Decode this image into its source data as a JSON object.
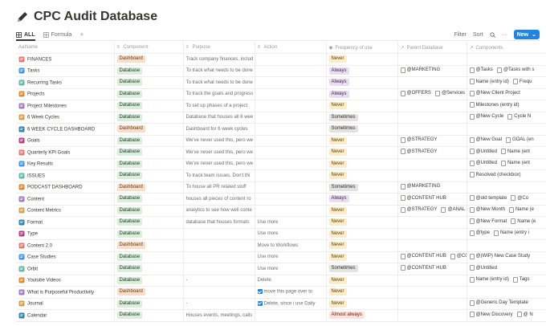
{
  "page": {
    "title": "CPC Audit Database",
    "title_icon": "pencil-icon"
  },
  "views": {
    "tabs": [
      {
        "label": "ALL",
        "icon": "table-icon",
        "active": true
      },
      {
        "label": "Formula",
        "icon": "table-icon",
        "active": false
      }
    ],
    "add_view": "+",
    "filter": "Filter",
    "sort": "Sort",
    "search_icon": "search-icon",
    "more": "···",
    "new_button": "New",
    "new_chevron": "⌄"
  },
  "columns": [
    {
      "label": "Name",
      "icon": "Aa"
    },
    {
      "label": "Component",
      "icon": "≡"
    },
    {
      "label": "Purpose",
      "icon": "≡"
    },
    {
      "label": "Action",
      "icon": "≡"
    },
    {
      "label": "Frequency of use",
      "icon": "◉"
    },
    {
      "label": "Parent Database",
      "icon": "↗"
    },
    {
      "label": "Components",
      "icon": "↗"
    }
  ],
  "colors": {
    "Dashboard": "#fadec9",
    "Database": "#dbeddb",
    "Never": "#fdecc8",
    "Always": "#e8deee",
    "Sometimes": "#e3e2e0",
    "Almost always": "#ffe2dd",
    "accent": "#2383e2"
  },
  "rows": [
    {
      "name": "FINANCES",
      "icon": "money-icon",
      "component": "Dashboard",
      "purpose": "Track company finances, includ",
      "action": "",
      "frequency": "Never",
      "parent": [],
      "components": []
    },
    {
      "name": "Tasks",
      "icon": "task-list-icon",
      "component": "Database",
      "purpose": "To track what needs to be done",
      "action": "",
      "frequency": "Always",
      "parent": [
        "@MARKETING"
      ],
      "components": [
        "@Tasks",
        "@Tasks with s"
      ]
    },
    {
      "name": "Recurring Tasks",
      "icon": "recurring-icon",
      "component": "Database",
      "purpose": "To track what needs to be done",
      "action": "",
      "frequency": "Always",
      "parent": [],
      "components": [
        "Name (entry id)",
        "Frequ"
      ]
    },
    {
      "name": "Projects",
      "icon": "projects-icon",
      "component": "Database",
      "purpose": "To track the goals and progress",
      "action": "",
      "frequency": "Always",
      "parent": [
        "@OFFERS",
        "@Services"
      ],
      "components": [
        "@New Client Project"
      ]
    },
    {
      "name": "Project Milestones",
      "icon": "milestone-icon",
      "component": "Database",
      "purpose": "To set up phases of a project",
      "action": "",
      "frequency": "Never",
      "parent": [],
      "components": [
        "Milestones (entry id)"
      ]
    },
    {
      "name": "6 Week Cycles",
      "icon": "chart-icon",
      "component": "Database",
      "purpose": "Database that houses all 6 wee",
      "action": "",
      "frequency": "Sometimes",
      "parent": [],
      "components": [
        "@New Cycle",
        "Cycle N"
      ]
    },
    {
      "name": "6 WEEK CYCLE DASHBOARD",
      "icon": "chart-icon",
      "component": "Dashboard",
      "purpose": "Dashboard for 6 week cycles",
      "action": "",
      "frequency": "Sometimes",
      "parent": [],
      "components": []
    },
    {
      "name": "Goals",
      "icon": "goals-icon",
      "component": "Database",
      "purpose": "We've never used this, pero we",
      "action": "",
      "frequency": "Never",
      "parent": [
        "@STRATEGY"
      ],
      "components": [
        "@New Goal",
        "GOAL (en"
      ]
    },
    {
      "name": "Quarterly KPI Goals",
      "icon": "kpi-icon",
      "component": "Database",
      "purpose": "We've never used this, pero we",
      "action": "",
      "frequency": "Never",
      "parent": [
        "@STRATEGY"
      ],
      "components": [
        "@Untitled",
        "Name (ent"
      ]
    },
    {
      "name": "Key Results",
      "icon": "key-results-icon",
      "component": "Database",
      "purpose": "We've never used this, pero we",
      "action": "",
      "frequency": "Never",
      "parent": [],
      "components": [
        "@Untitled",
        "Name (ent"
      ]
    },
    {
      "name": "ISSUES",
      "icon": "issues-icon",
      "component": "Database",
      "purpose": "To track team issues. Don't thi",
      "action": "",
      "frequency": "Never",
      "parent": [],
      "components": [
        "Resolved (checkbox)"
      ]
    },
    {
      "name": "PODCAST DASHBOARD",
      "icon": "podcast-icon",
      "component": "Dashboard",
      "purpose": "To house all PR related stuff",
      "action": "",
      "frequency": "Sometimes",
      "parent": [
        "@MARKETING"
      ],
      "components": []
    },
    {
      "name": "Content",
      "icon": "content-icon",
      "component": "Database",
      "purpose": "houses all pieces of content ro",
      "action": "",
      "frequency": "Always",
      "parent": [
        "@CONTENT HUB"
      ],
      "components": [
        "@old template",
        "@Co"
      ]
    },
    {
      "name": "Content Metrics",
      "icon": "metrics-icon",
      "component": "Database",
      "purpose": "analytics to see how well conte",
      "action": "",
      "frequency": "Never",
      "parent": [
        "@STRATEGY",
        "@ANAL"
      ],
      "components": [
        "@New Month",
        "Name (e"
      ]
    },
    {
      "name": "Format",
      "icon": "format-icon",
      "component": "Database",
      "purpose": "database that houses formats",
      "action": "Use more",
      "frequency": "Never",
      "parent": [],
      "components": [
        "@New Format",
        "Name (e"
      ]
    },
    {
      "name": "Type",
      "icon": "type-icon",
      "component": "Database",
      "purpose": "",
      "action": "Use more",
      "frequency": "Never",
      "parent": [],
      "components": [
        "@type",
        "Name (entry i"
      ]
    },
    {
      "name": "Content 2.0",
      "icon": "page-icon",
      "component": "Dashboard",
      "purpose": "",
      "action": "Move to  Workflows",
      "frequency": "Never",
      "parent": [],
      "components": []
    },
    {
      "name": "Case Studies",
      "icon": "case-studies-icon",
      "component": "Database",
      "purpose": "",
      "action": "Use more",
      "frequency": "Never",
      "parent": [
        "@CONTENT HUB",
        "@CO"
      ],
      "components": [
        "@(WIP) New Case Study"
      ]
    },
    {
      "name": "Orbit",
      "icon": "orbit-icon",
      "component": "Database",
      "purpose": "",
      "action": "Use more",
      "frequency": "Sometimes",
      "parent": [
        "@CONTENT HUB"
      ],
      "components": [
        "@Untitled"
      ]
    },
    {
      "name": "Youtube Videos",
      "icon": "video-icon",
      "component": "Database",
      "purpose": "-",
      "action": "Delete",
      "frequency": "Never",
      "parent": [],
      "components": [
        "Name (entry id)",
        "Tags"
      ]
    },
    {
      "name": "What is Purposeful Productivity",
      "icon": "question-icon",
      "component": "Dashboard",
      "purpose": "",
      "action": "move this page over to",
      "action_check": true,
      "frequency": "Never",
      "parent": [],
      "components": []
    },
    {
      "name": "Journal",
      "icon": "journal-icon",
      "component": "Database",
      "purpose": "-",
      "action": "Delete, since i use  Daily",
      "action_check": true,
      "frequency": "Never",
      "parent": [],
      "components": [
        "@Generic Day Template"
      ]
    },
    {
      "name": "Calendar",
      "icon": "calendar-icon",
      "component": "Database",
      "purpose": "Houses events, meetings, calls",
      "action": "",
      "frequency": "Almost always",
      "parent": [],
      "components": [
        "@New Discovery",
        "@ N"
      ]
    }
  ]
}
